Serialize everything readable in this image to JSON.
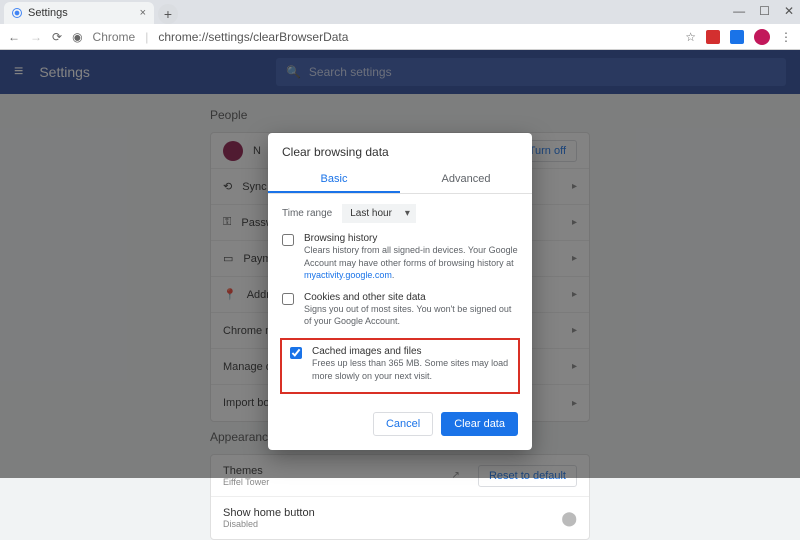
{
  "window": {
    "tab_title": "Settings",
    "url_prefix": "Chrome",
    "url": "chrome://settings/clearBrowserData"
  },
  "topbar": {
    "title": "Settings",
    "search_placeholder": "Search settings"
  },
  "sections": {
    "people": "People",
    "appearance": "Appearance",
    "turn_off": "Turn off",
    "reset": "Reset to default",
    "rows": {
      "sync": "Sync",
      "passwords": "Passwords",
      "payment": "Payment methods",
      "addresses": "Addresses and more",
      "chrome_name": "Chrome name and picture",
      "manage": "Manage other people",
      "import": "Import bookmarks and settings",
      "themes": "Themes",
      "themes_sub": "Eiffel Tower",
      "home": "Show home button",
      "home_sub": "Disabled"
    }
  },
  "modal": {
    "title": "Clear browsing data",
    "tabs": {
      "basic": "Basic",
      "advanced": "Advanced"
    },
    "time_label": "Time range",
    "time_value": "Last hour",
    "items": [
      {
        "title": "Browsing history",
        "desc": "Clears history from all signed-in devices. Your Google Account may have other forms of browsing history at ",
        "link": "myactivity.google.com",
        "checked": false
      },
      {
        "title": "Cookies and other site data",
        "desc": "Signs you out of most sites. You won't be signed out of your Google Account.",
        "checked": false
      },
      {
        "title": "Cached images and files",
        "desc": "Frees up less than 365 MB. Some sites may load more slowly on your next visit.",
        "checked": true
      }
    ],
    "cancel": "Cancel",
    "clear": "Clear data"
  }
}
